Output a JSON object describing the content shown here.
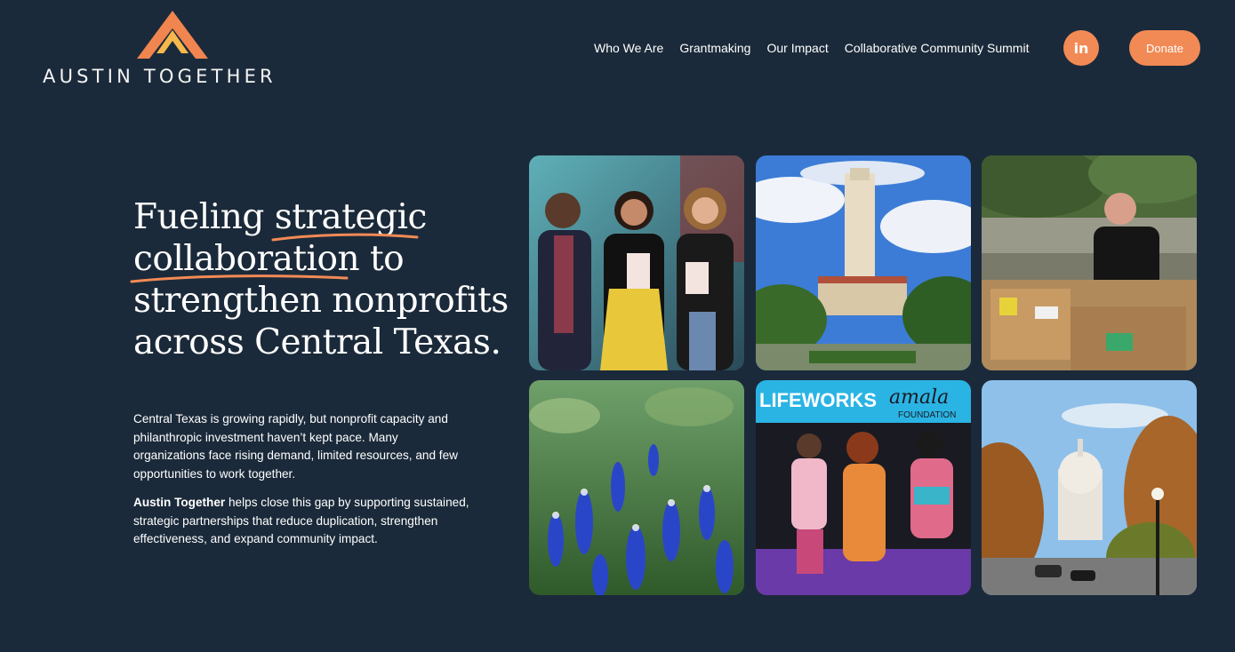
{
  "brand": {
    "name": "AUSTIN TOGETHER"
  },
  "nav": {
    "items": [
      "Who We Are",
      "Grantmaking",
      "Our Impact",
      "Collaborative Community Summit"
    ],
    "linkedin_label": "in",
    "donate_label": "Donate"
  },
  "hero": {
    "headline_part1": "Fueling ",
    "headline_hl1": "strategic",
    "headline_hl2": "collaboration",
    "headline_part2": " to strengthen nonprofits across Central Texas.",
    "paragraph1": "Central Texas is growing rapidly, but nonprofit capacity and philanthropic investment haven’t kept pace. Many organizations face rising demand, limited resources, and few opportunities to work together.",
    "paragraph2_bold": "Austin Together",
    "paragraph2_rest": " helps close this gap by supporting sustained, strategic partnerships that reduce duplication, strengthen effectiveness, and expand community impact."
  },
  "photos": [
    {
      "name": "photo-women-with-books"
    },
    {
      "name": "photo-ut-tower"
    },
    {
      "name": "photo-food-drive-volunteer"
    },
    {
      "name": "photo-bluebonnets"
    },
    {
      "name": "photo-panel-discussion",
      "sign_left": "LIFEWORKS",
      "sign_right": "amala",
      "sign_sub": "FOUNDATION"
    },
    {
      "name": "photo-texas-capitol"
    }
  ],
  "colors": {
    "background": "#1b2a3a",
    "accent": "#f28a55"
  }
}
